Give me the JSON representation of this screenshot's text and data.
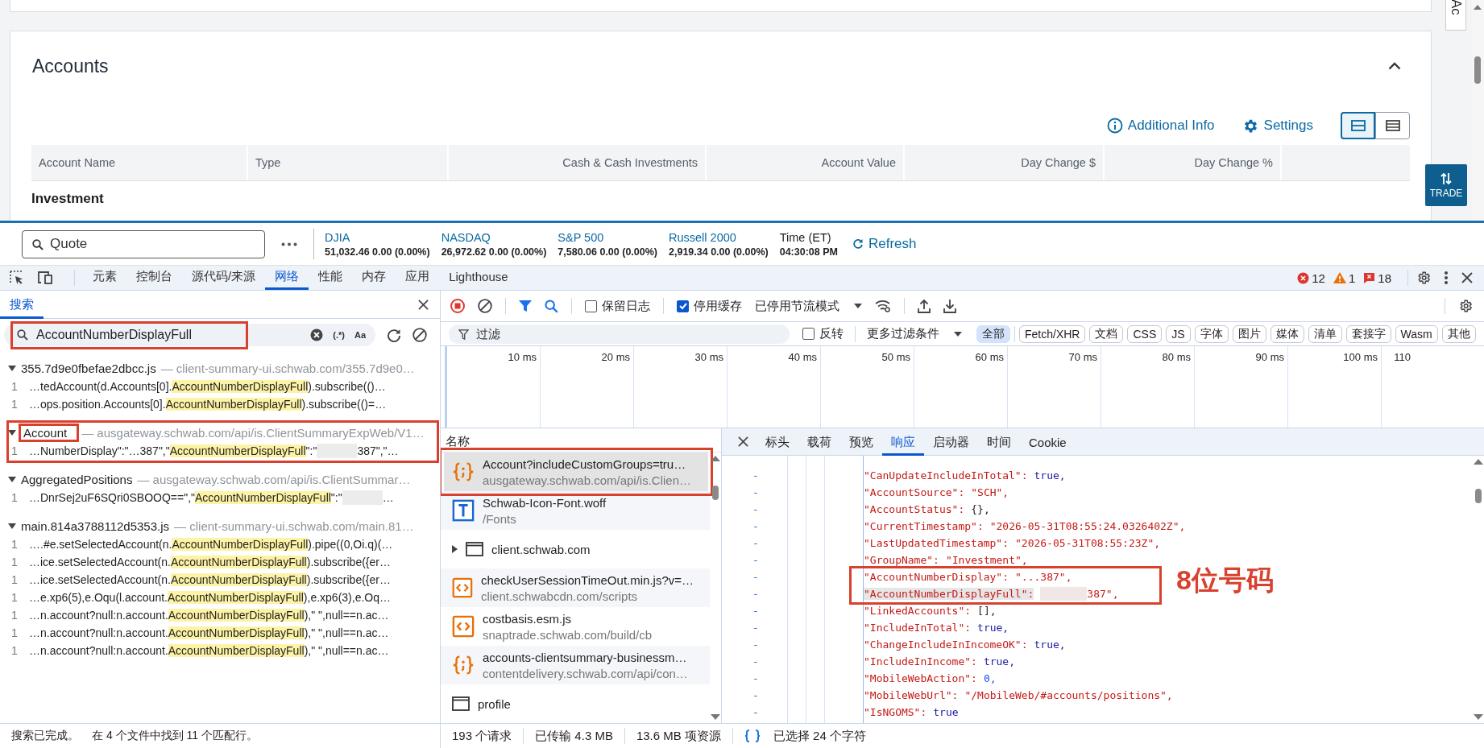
{
  "page": {
    "side_tab": "Ac",
    "accounts": {
      "title": "Accounts",
      "links": [
        {
          "kind": "info",
          "label": "Additional Info"
        },
        {
          "kind": "settings",
          "label": "Settings"
        }
      ],
      "view_modes": [
        {
          "kind": "cards",
          "selected": true
        },
        {
          "kind": "list",
          "selected": false
        }
      ],
      "columns": [
        "Account Name",
        "Type",
        "Cash & Cash Investments",
        "Account Value",
        "Day Change $",
        "Day Change %"
      ],
      "group": "Investment"
    },
    "trade": "TRADE"
  },
  "ticker": {
    "quote_placeholder": "Quote",
    "indices": [
      {
        "name": "DJIA",
        "value": "51,032.46 0.00 (0.00%)"
      },
      {
        "name": "NASDAQ",
        "value": "26,972.62 0.00 (0.00%)"
      },
      {
        "name": "S&P 500",
        "value": "7,580.06 0.00 (0.00%)"
      },
      {
        "name": "Russell 2000",
        "value": "2,919.34 0.00 (0.00%)"
      }
    ],
    "time_label": "Time (ET)",
    "time": "04:30:08 PM",
    "refresh": "Refresh"
  },
  "devtools": {
    "tabs": [
      {
        "label": "元素",
        "selected": false
      },
      {
        "label": "控制台",
        "selected": false
      },
      {
        "label": "源代码/来源",
        "selected": false
      },
      {
        "label": "网络",
        "selected": true
      },
      {
        "label": "性能",
        "selected": false
      },
      {
        "label": "内存",
        "selected": false
      },
      {
        "label": "应用",
        "selected": false
      },
      {
        "label": "Lighthouse",
        "selected": false
      }
    ],
    "issues": {
      "errors": "12",
      "warnings": "1",
      "messages": "18"
    },
    "search": {
      "title": "搜索",
      "query": "AccountNumberDisplayFull",
      "annotated": true,
      "regex_toggle": "(.*)",
      "case_toggle": "Aa",
      "results": [
        {
          "file": "355.7d9e0fbefae2dbcc.js",
          "url": "— client-summary-ui.schwab.com/355.7d9e0…",
          "annotated": false,
          "matches": [
            {
              "line": "1",
              "before": "…tedAccount(d.Accounts[0].",
              "match": "AccountNumberDisplayFull",
              "after": ").subscribe(()…",
              "redacted": false
            },
            {
              "line": "1",
              "before": "…ops.position.Accounts[0].",
              "match": "AccountNumberDisplayFull",
              "after": ").subscribe(()=…",
              "redacted": false
            }
          ]
        },
        {
          "file": "Account",
          "url": "— ausgateway.schwab.com/api/is.ClientSummaryExpWeb/V1…",
          "annotated": true,
          "matches": [
            {
              "line": "1",
              "before": "…NumberDisplay\":\"…387\",\"",
              "match": "AccountNumberDisplayFull",
              "after": "\":\"",
              "redacted": true,
              "tail": "387\",\"…"
            }
          ]
        },
        {
          "file": "AggregatedPositions",
          "url": "— ausgateway.schwab.com/api/is.ClientSummar…",
          "annotated": false,
          "matches": [
            {
              "line": "1",
              "before": "…DnrSej2uF6SQri0SBOOQ==\",\"",
              "match": "AccountNumberDisplayFull",
              "after": "\":\"",
              "redacted": true,
              "tail": "…"
            }
          ]
        },
        {
          "file": "main.814a3788112d5353.js",
          "url": "— client-summary-ui.schwab.com/main.81…",
          "annotated": false,
          "matches": [
            {
              "line": "1",
              "before": "….#e.setSelectedAccount(n.",
              "match": "AccountNumberDisplayFull",
              "after": ").pipe((0,Oi.q)(…",
              "redacted": false
            },
            {
              "line": "1",
              "before": "…ice.setSelectedAccount(n.",
              "match": "AccountNumberDisplayFull",
              "after": ").subscribe({er…",
              "redacted": false
            },
            {
              "line": "1",
              "before": "…ice.setSelectedAccount(n.",
              "match": "AccountNumberDisplayFull",
              "after": ").subscribe({er…",
              "redacted": false
            },
            {
              "line": "1",
              "before": "…e.xp6(5),e.Oqu(l.account.",
              "match": "AccountNumberDisplayFull",
              "after": "),e.xp6(3),e.Oq…",
              "redacted": false
            },
            {
              "line": "1",
              "before": "…n.account?null:n.account.",
              "match": "AccountNumberDisplayFull",
              "after": "),\" \",null==n.ac…",
              "redacted": false
            },
            {
              "line": "1",
              "before": "…n.account?null:n.account.",
              "match": "AccountNumberDisplayFull",
              "after": "),\" \",null==n.ac…",
              "redacted": false
            },
            {
              "line": "1",
              "before": "…n.account?null:n.account.",
              "match": "AccountNumberDisplayFull",
              "after": "),\" \",null==n.ac…",
              "redacted": false
            }
          ]
        }
      ],
      "status": [
        "搜索已完成。",
        "在 4 个文件中找到 11 个匹配行。"
      ]
    },
    "network": {
      "preserve_log": {
        "label": "保留日志",
        "checked": false
      },
      "disable_cache": {
        "label": "停用缓存",
        "checked": true
      },
      "throttle": "已停用节流模式",
      "filter_placeholder": "过滤",
      "invert": {
        "label": "反转",
        "checked": false
      },
      "more_filters": "更多过滤条件",
      "types": [
        {
          "label": "全部",
          "selected": true
        },
        {
          "label": "Fetch/XHR",
          "selected": false
        },
        {
          "label": "文档",
          "selected": false
        },
        {
          "label": "CSS",
          "selected": false
        },
        {
          "label": "JS",
          "selected": false
        },
        {
          "label": "字体",
          "selected": false
        },
        {
          "label": "图片",
          "selected": false
        },
        {
          "label": "媒体",
          "selected": false
        },
        {
          "label": "清单",
          "selected": false
        },
        {
          "label": "套接字",
          "selected": false
        },
        {
          "label": "Wasm",
          "selected": false
        },
        {
          "label": "其他",
          "selected": false
        }
      ],
      "timeline_ticks": [
        "10 ms",
        "20 ms",
        "30 ms",
        "40 ms",
        "50 ms",
        "60 ms",
        "70 ms",
        "80 ms",
        "90 ms",
        "100 ms",
        "110"
      ],
      "name_header": "名称",
      "requests": [
        {
          "kind": "json",
          "name": "Account?includeCustomGroups=tru…",
          "url": "ausgateway.schwab.com/api/is.Clien…",
          "selected": true,
          "annotated": true
        },
        {
          "kind": "font",
          "name": "Schwab-Icon-Font.woff",
          "url": "/Fonts",
          "selected": false,
          "annotated": false
        },
        {
          "kind": "frame",
          "name": "client.schwab.com",
          "selected": false,
          "annotated": false
        },
        {
          "kind": "script",
          "name": "checkUserSessionTimeOut.min.js?v=…",
          "url": "client.schwabcdn.com/scripts",
          "selected": false,
          "annotated": false
        },
        {
          "kind": "script",
          "name": "costbasis.esm.js",
          "url": "snaptrade.schwab.com/build/cb",
          "selected": false,
          "annotated": false
        },
        {
          "kind": "json",
          "name": "accounts-clientsummary-businessm…",
          "url": "contentdelivery.schwab.com/api/con…",
          "selected": false,
          "annotated": false
        },
        {
          "kind": "document",
          "name": "profile",
          "selected": false,
          "annotated": false
        }
      ],
      "status": [
        "193 个请求",
        "已传输 4.3 MB",
        "13.6 MB 项资源"
      ]
    },
    "details": {
      "tabs": [
        {
          "label": "标头",
          "selected": false
        },
        {
          "label": "载荷",
          "selected": false
        },
        {
          "label": "预览",
          "selected": false
        },
        {
          "label": "响应",
          "selected": true
        },
        {
          "label": "启动器",
          "selected": false
        },
        {
          "label": "时间",
          "selected": false
        },
        {
          "label": "Cookie",
          "selected": false
        }
      ],
      "lines": [
        {
          "marker": "-",
          "key": "\"CanUpdateIncludeInTotal\":",
          "value": "true,",
          "kind": "keyword",
          "selected": false,
          "redacted": false,
          "annotated": false
        },
        {
          "marker": "-",
          "key": "\"AccountSource\":",
          "value": "\"SCH\",",
          "kind": "string",
          "selected": false,
          "redacted": false,
          "annotated": false
        },
        {
          "marker": "-",
          "key": "\"AccountStatus\":",
          "value": "{},",
          "kind": "plain",
          "selected": false,
          "redacted": false,
          "annotated": false
        },
        {
          "marker": "-",
          "key": "\"CurrentTimestamp\":",
          "value": "\"2026-05-31T08:55:24.0326402Z\",",
          "kind": "string",
          "selected": false,
          "redacted": false,
          "annotated": false
        },
        {
          "marker": "-",
          "key": "\"LastUpdatedTimestamp\":",
          "value": "\"2026-05-31T08:55:23Z\",",
          "kind": "string",
          "selected": false,
          "redacted": false,
          "annotated": false
        },
        {
          "marker": "-",
          "key": "\"GroupName\":",
          "value": "\"Investment\",",
          "kind": "string",
          "selected": false,
          "redacted": false,
          "annotated": false
        },
        {
          "marker": "-",
          "key": "\"AccountNumberDisplay\":",
          "value": "\"...387\",",
          "kind": "string",
          "selected": false,
          "redacted": false,
          "annotated": true
        },
        {
          "marker": "-",
          "key": "\"AccountNumberDisplayFull\":",
          "value": "387\",",
          "kind": "string",
          "selected": true,
          "redacted": true,
          "annotated": true
        },
        {
          "marker": "-",
          "key": "\"LinkedAccounts\":",
          "value": "[],",
          "kind": "plain",
          "selected": false,
          "redacted": false,
          "annotated": false
        },
        {
          "marker": "-",
          "key": "\"IncludeInTotal\":",
          "value": "true,",
          "kind": "keyword",
          "selected": false,
          "redacted": false,
          "annotated": false
        },
        {
          "marker": "-",
          "key": "\"ChangeIncludeInIncomeOK\":",
          "value": "true,",
          "kind": "keyword",
          "selected": false,
          "redacted": false,
          "annotated": false
        },
        {
          "marker": "-",
          "key": "\"IncludeInIncome\":",
          "value": "true,",
          "kind": "keyword",
          "selected": false,
          "redacted": false,
          "annotated": false
        },
        {
          "marker": "-",
          "key": "\"MobileWebAction\":",
          "value": "0,",
          "kind": "number",
          "selected": false,
          "redacted": false,
          "annotated": false
        },
        {
          "marker": "-",
          "key": "\"MobileWebUrl\":",
          "value": "\"/MobileWeb/#accounts/positions\",",
          "kind": "string",
          "selected": false,
          "redacted": false,
          "annotated": false
        },
        {
          "marker": "-",
          "key": "\"IsNGOMS\":",
          "value": "true",
          "kind": "keyword",
          "selected": false,
          "redacted": false,
          "annotated": false
        }
      ],
      "note": "8位号码",
      "status": "已选择 24 个字符"
    }
  }
}
